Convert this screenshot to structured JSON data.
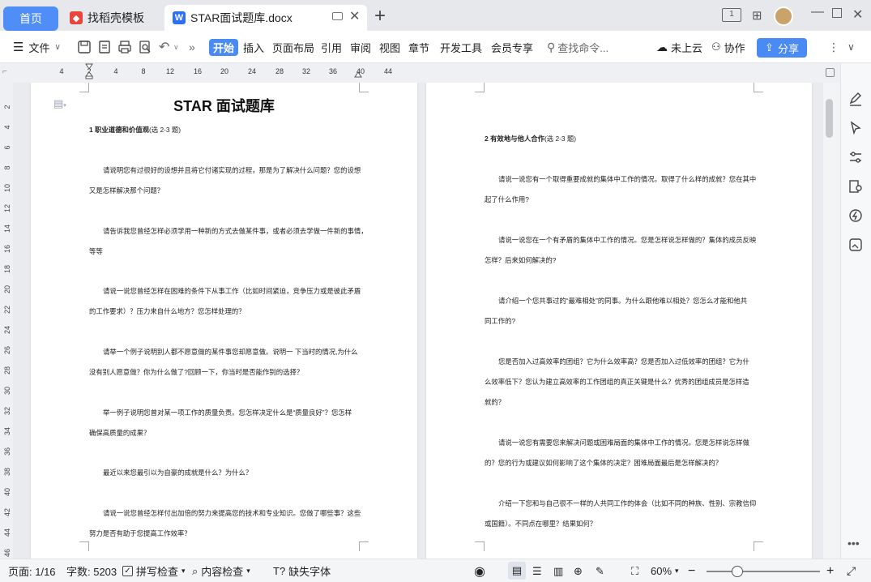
{
  "tabs": {
    "home": "首页",
    "daoke": "找稻壳模板",
    "doc": "STAR面试题库.docx",
    "doc_icon": "W"
  },
  "ribbon": {
    "file": "文件",
    "menus": [
      "开始",
      "插入",
      "页面布局",
      "引用",
      "审阅",
      "视图",
      "章节",
      "开发工具",
      "会员专享"
    ],
    "search_placeholder": "查找命令...",
    "cloud": "未上云",
    "collab": "协作",
    "share": "分享"
  },
  "ruler": {
    "ticks": [
      "4",
      "2",
      "4",
      "8",
      "12",
      "16",
      "20",
      "24",
      "28",
      "32",
      "36",
      "40",
      "44"
    ]
  },
  "vruler": {
    "ticks": [
      "2",
      "4",
      "6",
      "8",
      "10",
      "12",
      "14",
      "16",
      "18",
      "20",
      "22",
      "24",
      "26",
      "28",
      "30",
      "32",
      "34",
      "36",
      "38",
      "40",
      "42",
      "44",
      "46"
    ]
  },
  "page1": {
    "title": "STAR 面试题库",
    "section": "1 职业道德和价值观",
    "section_note": "(选 2-3 题)",
    "lines": [
      "请说明您有过很好的设想并且将它付诸实现的过程，那是为了解决什么问题？您的设想",
      "又是怎样解决那个问题？",
      "请告诉我您曾经怎样必须学用一种新的方式去做某件事，或者必须去学做一件新的事情，",
      "等等",
      "请说一说您曾经怎样在困难的条件下从事工作（比如时间紧迫，竞争压力或是彼此矛盾",
      "的工作要求）？压力来自什么地方？您怎样处理的？",
      "请举一个例子说明别人都不愿意做的某件事您却愿意做。说明一 下当时的情况,为什么",
      "没有别人愿意做？你为什么做了?回顾一下，你当时是否能作别的选择？",
      "举一例子说明您曾对某一项工作的质量负责。您怎样决定什么是“质量良好”？您怎样",
      "确保高质量的成果？",
      "最近以来您最引以为自豪的成就是什么？为什么？",
      "请说一说您曾经怎样付出加倍的努力来提高您的技术和专业知识。您做了哪些事？这些",
      "努力是否有助于您提高工作效率？"
    ]
  },
  "page2": {
    "section": "2 有效地与他人合作",
    "section_note": "(选 2-3 题)",
    "lines": [
      "请说一说您有一个取得重要成就的集体中工作的情况。取得了什么样的成就？您在其中",
      "起了什么作用?",
      "请说一说您在一个有矛盾的集体中工作的情况。您是怎样说怎样做的？集体的成员反映",
      "怎样？后来如何解决的?",
      "请介绍一个您共事过的“最难相处”的同事。为什么跟他难以相处？您怎么才能和他共",
      "同工作的?",
      "您是否加入过高效率的团组？它为什么效率高？您是否加入过低效率的团组？它为什",
      "么效率低下？您认为建立高效率的工作团组的真正关键是什么？优秀的团组成员是怎样造",
      "就的？",
      "请说一说您有需要您来解决问题或困难局面的集体中工作的情况。您是怎样说怎样做",
      "的？您的行为或建议如何影响了这个集体的决定？困难局面最后是怎样解决的？",
      "介绍一下您和与自己很不一样的人共同工作的体会（比如不同的种族、性别、宗教信仰",
      "或国籍）。不同点在哪里？结果如何？"
    ]
  },
  "status": {
    "page": "页面: 1/16",
    "words": "字数: 5203",
    "spell": "拼写检查",
    "content_check": "内容检查",
    "missing_font": "缺失字体",
    "zoom": "60%"
  },
  "colors": {
    "accent": "#4a8af4",
    "home_tab": "#4f8ef6",
    "daoke": "#e8453c"
  }
}
